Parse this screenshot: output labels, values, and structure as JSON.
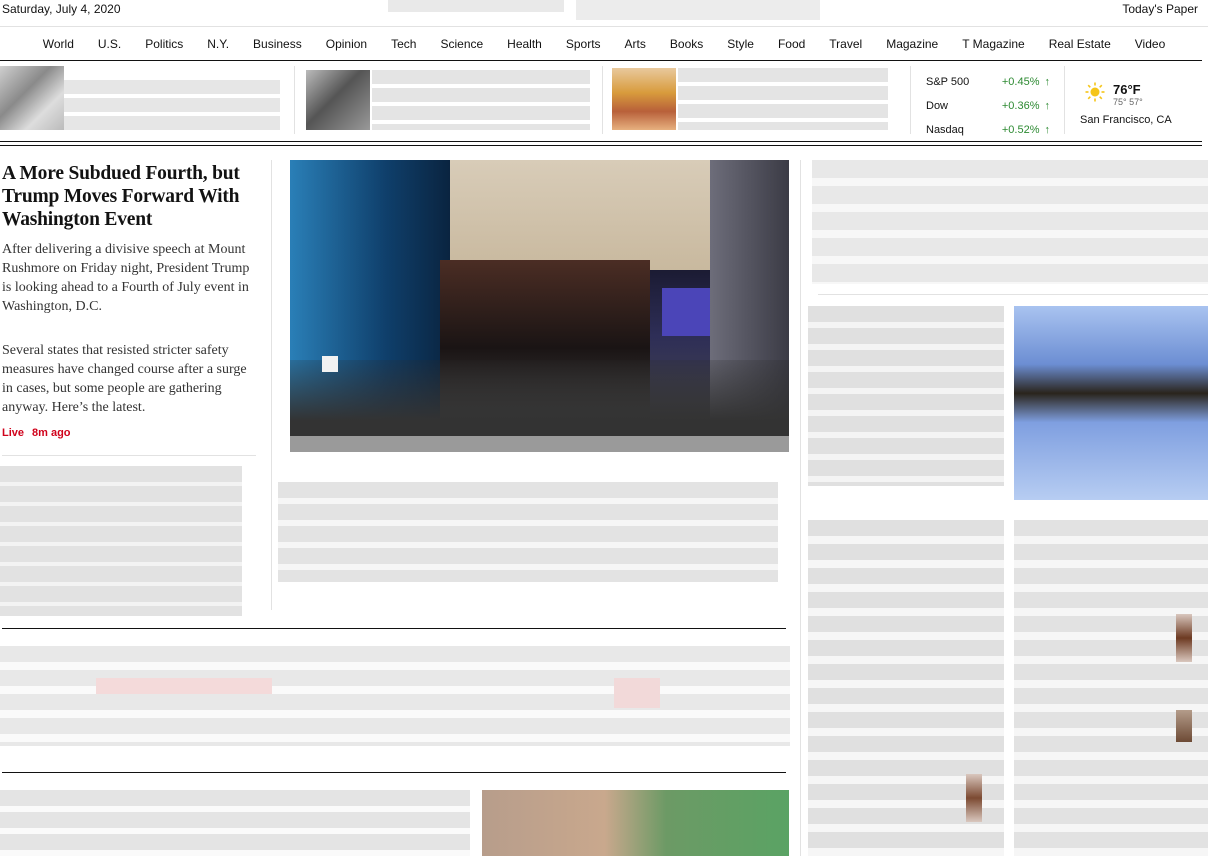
{
  "header": {
    "date": "Saturday, July 4, 2020",
    "todays_paper": "Today's Paper"
  },
  "nav": {
    "items": [
      "World",
      "U.S.",
      "Politics",
      "N.Y.",
      "Business",
      "Opinion",
      "Tech",
      "Science",
      "Health",
      "Sports",
      "Arts",
      "Books",
      "Style",
      "Food",
      "Travel",
      "Magazine",
      "T Magazine",
      "Real Estate",
      "Video"
    ]
  },
  "markets": {
    "rows": [
      {
        "name": "S&P 500",
        "change": "+0.45%",
        "arrow": "↑"
      },
      {
        "name": "Dow",
        "change": "+0.36%",
        "arrow": "↑"
      },
      {
        "name": "Nasdaq",
        "change": "+0.52%",
        "arrow": "↑"
      }
    ]
  },
  "weather": {
    "temp": "76°F",
    "hilo": "75°  57°",
    "location": "San Francisco, CA"
  },
  "lead": {
    "headline": "A More Subdued Fourth, but Trump Moves Forward With Washington Event",
    "summary1": "After delivering a divisive speech at Mount Rushmore on Friday night, President Trump is looking ahead to a Fourth of July event in Washington, D.C.",
    "summary2": "Several states that resisted stricter safety measures have changed course after a surge in cases, but some people are gathering anyway. Here’s the latest.",
    "live": "Live",
    "time": "8m ago"
  },
  "colors": {
    "live_red": "#d0021b",
    "market_green": "#2d8a32"
  }
}
